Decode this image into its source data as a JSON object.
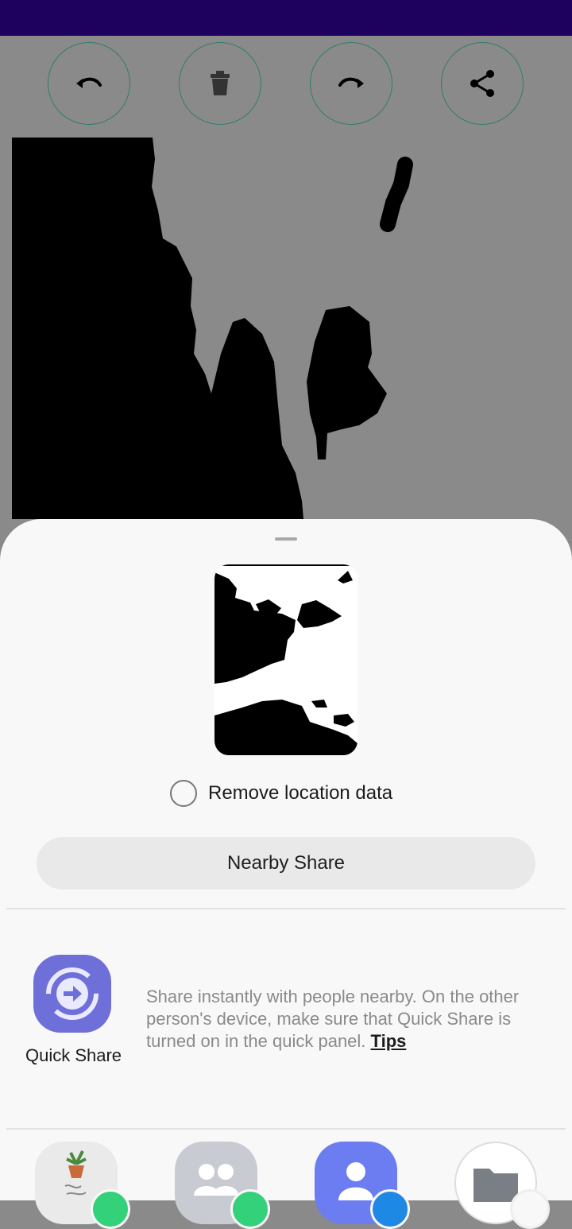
{
  "toolbar": {
    "undo_icon": "undo-icon",
    "delete_icon": "trash-icon",
    "redo_icon": "redo-icon",
    "share_icon": "share-icon"
  },
  "colors": {
    "status_bar": "#1e005e",
    "canvas_bg": "#8a8a8a",
    "sheet_bg": "#f8f8f8",
    "quick_share": "#6f6fd9",
    "accent_ring": "#2f7d6f"
  },
  "share_sheet": {
    "remove_location_label": "Remove location data",
    "nearby_share_label": "Nearby Share",
    "quick_share": {
      "label": "Quick Share",
      "description": "Share instantly with people nearby. On the other person's device, make sure that Quick Share is turned on in the quick panel.",
      "tips_link": "Tips"
    },
    "apps": [
      {
        "icon": "gallery-app-icon"
      },
      {
        "icon": "group-contacts-icon"
      },
      {
        "icon": "contact-icon"
      },
      {
        "icon": "my-files-folder-icon"
      }
    ]
  }
}
